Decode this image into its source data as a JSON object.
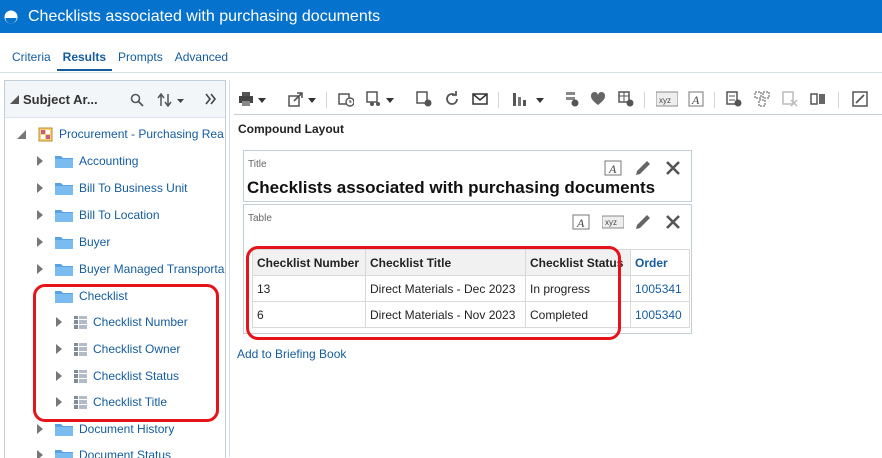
{
  "window": {
    "title": "Checklists associated with purchasing documents"
  },
  "tabs": [
    {
      "label": "Criteria",
      "active": false
    },
    {
      "label": "Results",
      "active": true
    },
    {
      "label": "Prompts",
      "active": false
    },
    {
      "label": "Advanced",
      "active": false
    }
  ],
  "subject_areas": {
    "header": "Subject Ar...",
    "root": "Procurement - Purchasing Rea",
    "folders_top": [
      "Accounting",
      "Bill To Business Unit",
      "Bill To Location",
      "Buyer",
      "Buyer Managed Transporta"
    ],
    "expanded_folder": "Checklist",
    "columns": [
      "Checklist Number",
      "Checklist Owner",
      "Checklist Status",
      "Checklist Title"
    ],
    "folders_bottom": [
      "Document History",
      "Document Status"
    ]
  },
  "layout": {
    "section_label": "Compound Layout"
  },
  "title_view": {
    "caption": "Title",
    "text": "Checklists associated with purchasing documents"
  },
  "table_view": {
    "caption": "Table",
    "headers": [
      "Checklist Number",
      "Checklist Title",
      "Checklist Status",
      "Order"
    ],
    "rows": [
      [
        "13",
        "Direct Materials - Dec 2023",
        "In progress",
        "1005341"
      ],
      [
        "6",
        "Direct Materials - Nov 2023",
        "Completed",
        "1005340"
      ]
    ]
  },
  "briefing": {
    "label": "Add to Briefing Book"
  },
  "colors": {
    "brand": "#0572ce",
    "link": "#145c9e",
    "annotation": "#e5141b"
  },
  "icons": [
    "print-icon",
    "export-icon",
    "schedule-icon",
    "filter-icon",
    "delete-icon",
    "refresh-icon",
    "email-icon",
    "chart-icon",
    "text-icon",
    "xyz-icon",
    "edit-icon",
    "close-icon"
  ]
}
